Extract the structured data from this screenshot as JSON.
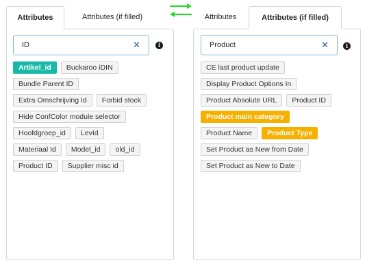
{
  "colors": {
    "highlight_teal": "#18b9a6",
    "highlight_orange": "#f6b000",
    "arrow_green": "#22dd22",
    "clear_icon": "#2f5f97"
  },
  "left": {
    "tabs": [
      {
        "label": "Attributes",
        "active": true
      },
      {
        "label": "Attributes (if filled)",
        "active": false
      }
    ],
    "search": {
      "value": "ID",
      "clear_icon": "close-icon"
    },
    "info_icon": "info-icon",
    "tag_rows": [
      [
        {
          "label": "Artikel_id",
          "highlight": "teal"
        },
        {
          "label": "Buckaroo iDIN"
        }
      ],
      [
        {
          "label": "Bundle Parent ID"
        }
      ],
      [
        {
          "label": "Extra Omschrijving Id"
        },
        {
          "label": "Forbid stock"
        }
      ],
      [
        {
          "label": "Hide ConfColor module selector"
        }
      ],
      [
        {
          "label": "Hoofdgroep_id"
        },
        {
          "label": "LevId"
        }
      ],
      [
        {
          "label": "Materiaal Id"
        },
        {
          "label": "Model_id"
        },
        {
          "label": "old_id"
        }
      ],
      [
        {
          "label": "Product ID"
        },
        {
          "label": "Supplier misc id"
        }
      ]
    ]
  },
  "right": {
    "tabs": [
      {
        "label": "Attributes",
        "active": false
      },
      {
        "label": "Attributes (if filled)",
        "active": true
      }
    ],
    "search": {
      "value": "Product",
      "clear_icon": "close-icon"
    },
    "info_icon": "info-icon",
    "tag_rows": [
      [
        {
          "label": "CE last product update"
        }
      ],
      [
        {
          "label": "Display Product Options In"
        }
      ],
      [
        {
          "label": "Product Absolute URL"
        },
        {
          "label": "Product ID"
        }
      ],
      [
        {
          "label": "Product main category",
          "highlight": "orange"
        }
      ],
      [
        {
          "label": "Product Name"
        },
        {
          "label": "Product Type",
          "highlight": "orange"
        }
      ],
      [
        {
          "label": "Set Product as New from Date"
        }
      ],
      [
        {
          "label": "Set Product as New to Date"
        }
      ]
    ]
  }
}
